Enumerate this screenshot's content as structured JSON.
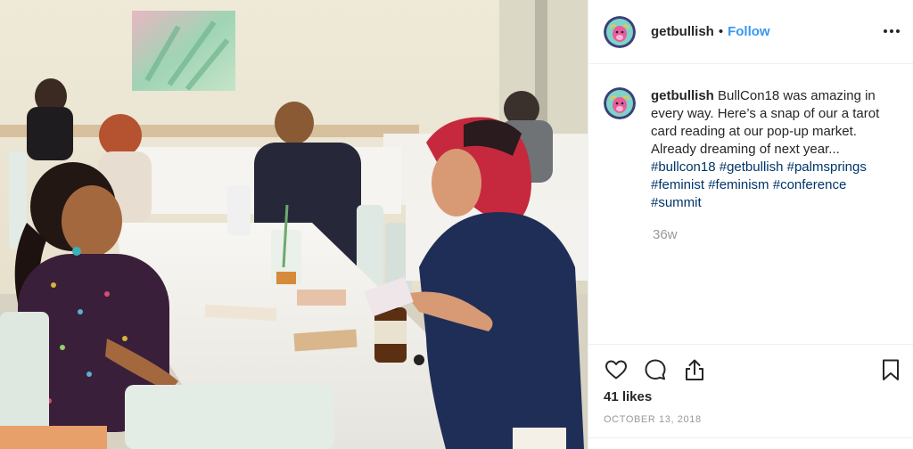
{
  "post": {
    "username": "getbullish",
    "separator": "•",
    "follow_label": "Follow",
    "caption": {
      "username": "getbullish",
      "text_line_1": " BullCon18 was amazing in every way. Here’s a snap of our a tarot card reading at our pop-up market. Already dreaming of next year... ",
      "hashtags": [
        "#bullcon18",
        "#getbullish",
        "#palmsprings",
        "#feminist",
        "#feminism",
        "#conference",
        "#summit"
      ]
    },
    "time_ago": "36w",
    "likes": "41 likes",
    "date": "OCTOBER 13, 2018"
  },
  "icons": {
    "more": "more-options-icon",
    "like": "heart-icon",
    "comment": "comment-icon",
    "share": "share-icon",
    "save": "bookmark-icon"
  },
  "colors": {
    "link": "#3897f0",
    "hashtag": "#003569",
    "muted": "#999999",
    "text": "#262626"
  }
}
